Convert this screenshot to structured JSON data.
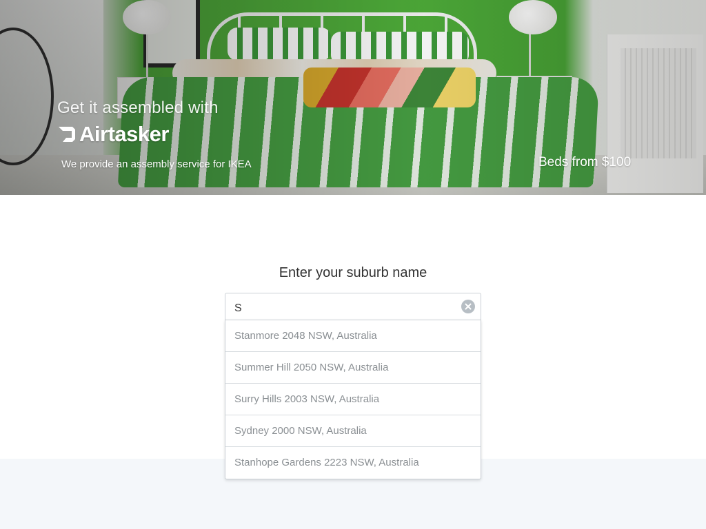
{
  "hero": {
    "tagline": "Get it assembled with",
    "brand": "Airtasker",
    "subtitle": "We provide an assembly service for IKEA",
    "offer": "Beds from $100"
  },
  "search": {
    "prompt": "Enter your suburb name",
    "value": "S",
    "placeholder": "",
    "clear_icon": "close-circle-icon"
  },
  "suggestions": [
    {
      "label": "Stanmore 2048 NSW, Australia"
    },
    {
      "label": "Summer Hill 2050 NSW, Australia"
    },
    {
      "label": "Surry Hills 2003 NSW, Australia"
    },
    {
      "label": "Sydney 2000 NSW, Australia"
    },
    {
      "label": "Stanhope Gardens 2223 NSW, Australia"
    }
  ],
  "colors": {
    "bed_green": "#4fae3a",
    "text_primary": "#333333",
    "suggestion_text": "#8a8f93",
    "lower_band": "#f4f7fa"
  }
}
